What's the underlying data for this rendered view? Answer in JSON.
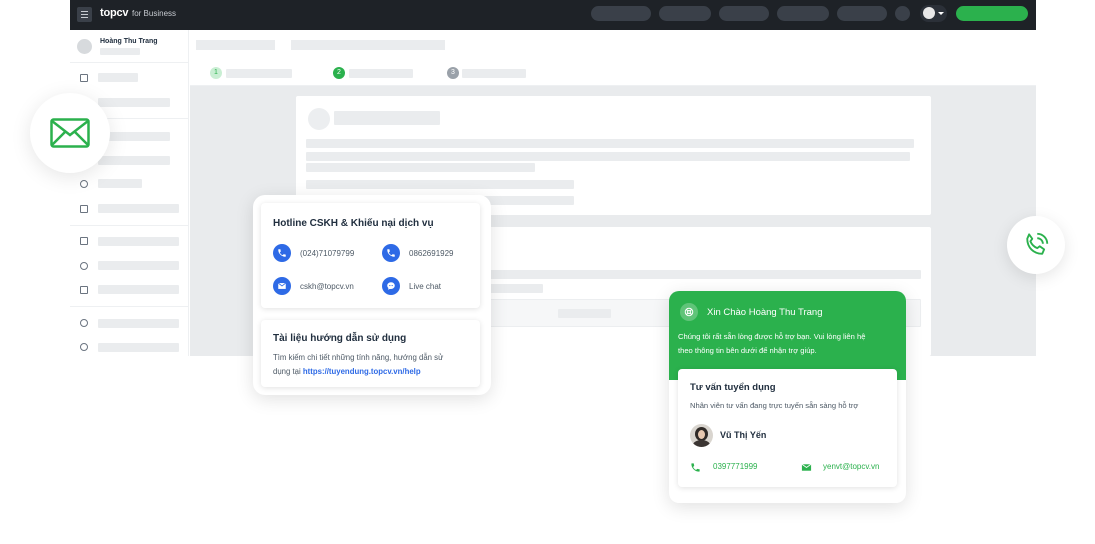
{
  "brand": {
    "name": "topcv",
    "suffix": "for Business"
  },
  "sidebar": {
    "user_name": "Hoàng Thu Trang"
  },
  "steps": [
    "1",
    "2",
    "3"
  ],
  "hotline_card": {
    "title": "Hotline CSKH & Khiếu nại dịch vụ",
    "phone1": "(024)71079799",
    "phone2": "0862691929",
    "email": "cskh@topcv.vn",
    "chat": "Live chat"
  },
  "guide_card": {
    "title": "Tài liệu hướng dẫn sử dụng",
    "desc_line1": "Tìm kiếm chi tiết những tính năng, hướng dẫn sử",
    "desc_prefix": "dụng tại",
    "link": "https://tuyendung.topcv.vn/help"
  },
  "support_popup": {
    "greeting": "Xin Chào Hoàng Thu Trang",
    "intro_line1": "Chúng tôi rất sẵn lòng được hỗ trợ bạn. Vui lòng liên hệ",
    "intro_line2": "theo thông tin bên dưới để nhận trợ giúp.",
    "section_title": "Tư vấn tuyển dụng",
    "section_desc": "Nhân viên tư vấn đang trực tuyến sẵn sàng hỗ trợ",
    "advisor_name": "Vũ Thị Yến",
    "advisor_phone": "0397771999",
    "advisor_email": "yenvt@topcv.vn"
  },
  "colors": {
    "accent_green": "#2bb14d",
    "accent_blue": "#2e6ae6",
    "topbar": "#1e2227"
  }
}
